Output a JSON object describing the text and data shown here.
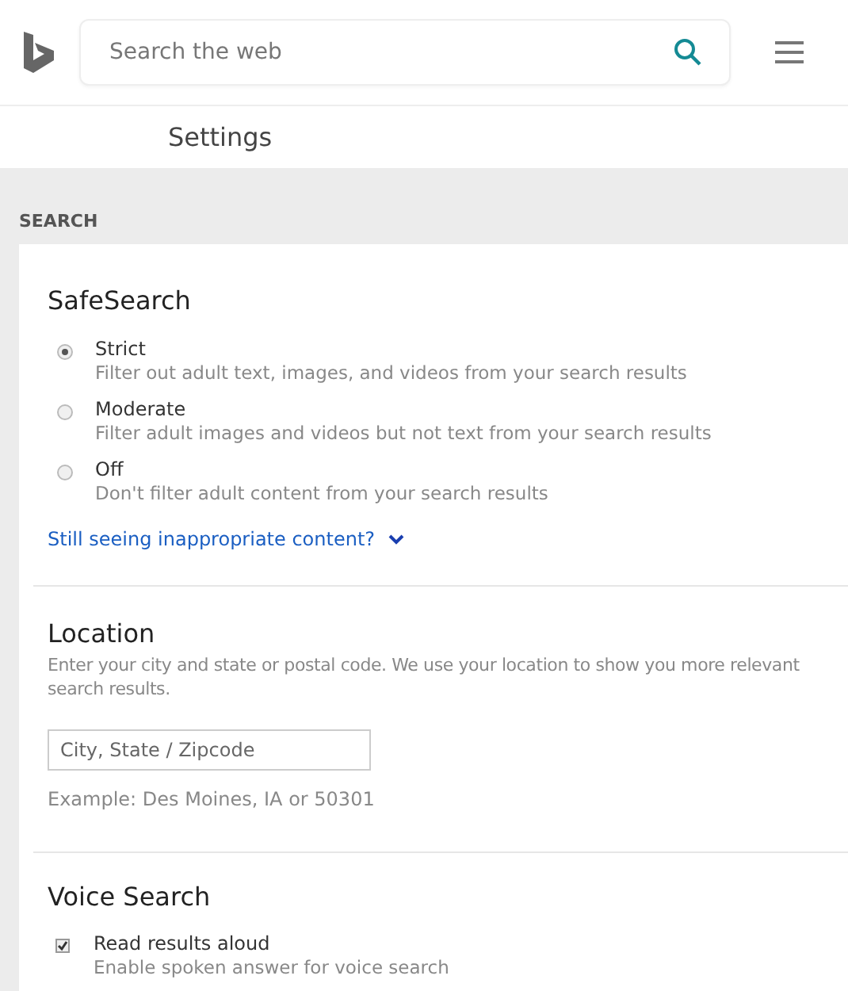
{
  "header": {
    "search": {
      "placeholder": "Search the web"
    }
  },
  "page_title": "Settings",
  "section_label": "SEARCH",
  "safesearch": {
    "title": "SafeSearch",
    "options": [
      {
        "label": "Strict",
        "description": "Filter out adult text, images, and videos from your search results",
        "selected": true
      },
      {
        "label": "Moderate",
        "description": "Filter adult images and videos but not text from your search results",
        "selected": false
      },
      {
        "label": "Off",
        "description": "Don't filter adult content from your search results",
        "selected": false
      }
    ],
    "link": {
      "text": "Still seeing inappropriate content?",
      "expanded": false
    }
  },
  "location": {
    "title": "Location",
    "description": "Enter your city and state or postal code. We use your location to show you more relevant search results.",
    "field": {
      "placeholder": "City, State / Zipcode"
    },
    "example": "Example: Des Moines, IA or 50301"
  },
  "voice_search": {
    "title": "Voice Search",
    "options": [
      {
        "label": "Read results aloud",
        "description": "Enable spoken answer for voice search",
        "checked": true
      }
    ]
  }
}
